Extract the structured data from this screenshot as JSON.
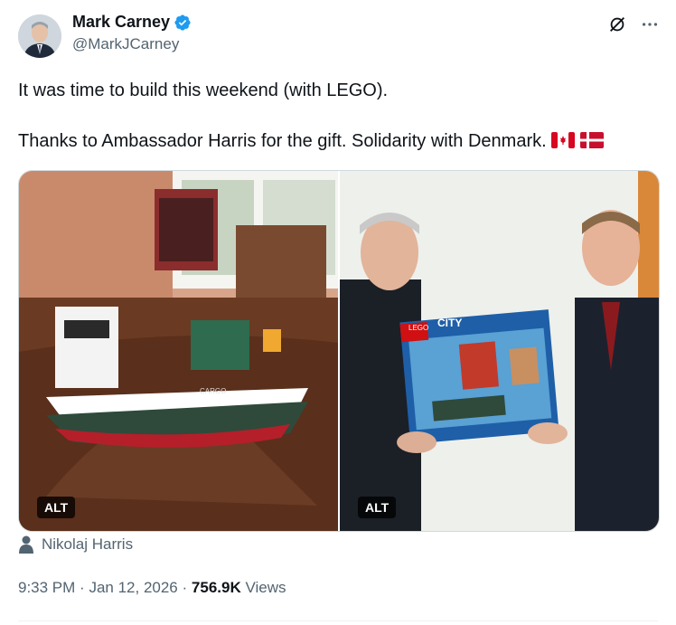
{
  "author": {
    "name": "Mark Carney",
    "handle": "@MarkJCarney",
    "verified_color": "#1d9bf0"
  },
  "tweet": {
    "line1": "It was time to build this weekend (with LEGO).",
    "line2": "Thanks to Ambassador Harris for the gift. Solidarity with Denmark.",
    "flags": [
      "canada-flag",
      "denmark-flag"
    ]
  },
  "media": [
    {
      "alt_label": "ALT",
      "description_icon": "lego-ship-photo"
    },
    {
      "alt_label": "ALT",
      "description_icon": "lego-box-handover-photo"
    }
  ],
  "tagged": {
    "name": "Nikolaj Harris"
  },
  "meta": {
    "time": "9:33 PM",
    "separator1": "·",
    "date": "Jan 12, 2026",
    "separator2": "·",
    "views_count": "756.9K",
    "views_label": "Views"
  }
}
